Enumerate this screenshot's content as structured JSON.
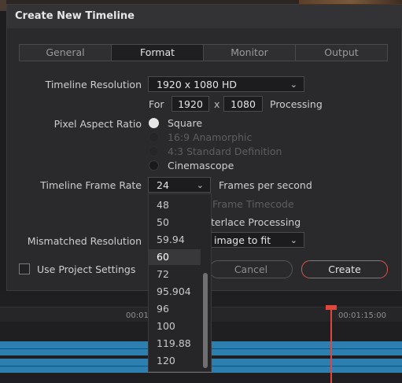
{
  "dialog": {
    "title": "Create New Timeline",
    "tabs": [
      {
        "label": "General",
        "active": false
      },
      {
        "label": "Format",
        "active": true
      },
      {
        "label": "Monitor",
        "active": false
      },
      {
        "label": "Output",
        "active": false
      }
    ]
  },
  "resolution": {
    "label": "Timeline Resolution",
    "value": "1920 x 1080 HD",
    "for_label": "For",
    "width": "1920",
    "x_label": "x",
    "height": "1080",
    "processing_label": "Processing"
  },
  "pixel_aspect": {
    "label": "Pixel Aspect Ratio",
    "options": [
      {
        "label": "Square",
        "state": "checked"
      },
      {
        "label": "16:9 Anamorphic",
        "state": "disabled"
      },
      {
        "label": "4:3 Standard Definition",
        "state": "disabled"
      },
      {
        "label": "Cinemascope",
        "state": "unchecked"
      }
    ]
  },
  "frame_rate": {
    "label": "Timeline Frame Rate",
    "value": "24",
    "suffix": "Frames per second",
    "partial_frame_timecode": "Frame Timecode",
    "partial_interlace": "terlace Processing",
    "options": [
      "48",
      "50",
      "59.94",
      "60",
      "72",
      "95.904",
      "96",
      "100",
      "119.88",
      "120"
    ],
    "highlighted": "60"
  },
  "mismatched": {
    "label": "Mismatched Resolution",
    "value_partial": "image to fit"
  },
  "footer": {
    "use_project_settings": "Use Project Settings",
    "cancel": "Cancel",
    "create": "Create"
  },
  "timeline": {
    "tc_left": "00:01",
    "tc_right": "00:01:15:00"
  },
  "colors": {
    "accent": "#d9564a",
    "track": "#2d7fb0",
    "playhead": "#e0463c"
  }
}
